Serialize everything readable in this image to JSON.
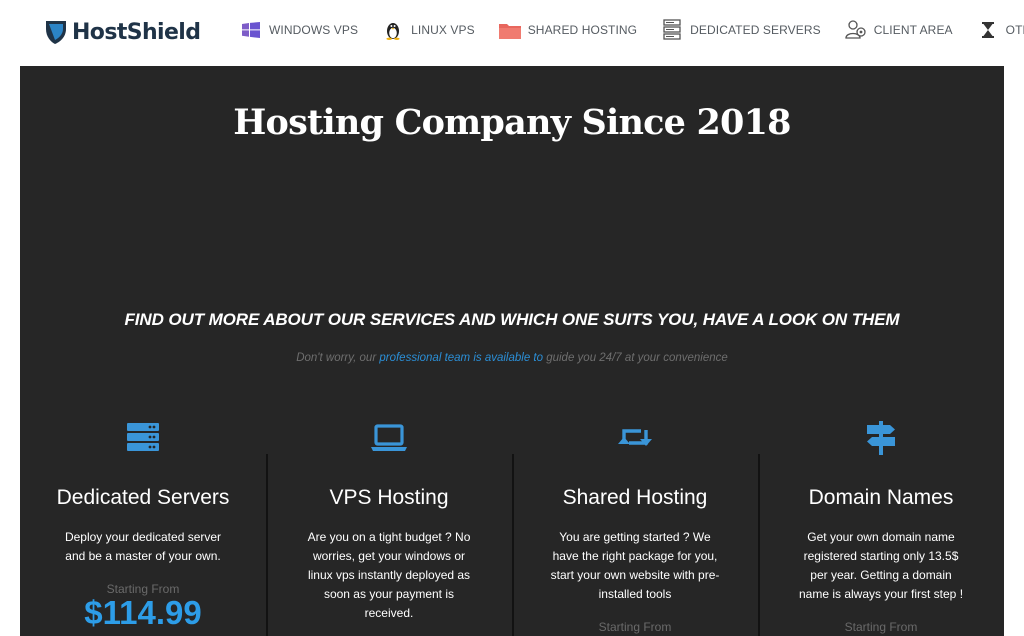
{
  "brand": {
    "name": "HostShield",
    "color": "#1f3347"
  },
  "nav": {
    "items": [
      {
        "label": "WINDOWS VPS",
        "icon": "windows-icon"
      },
      {
        "label": "LINUX VPS",
        "icon": "linux-penguin-icon"
      },
      {
        "label": "SHARED HOSTING",
        "icon": "folder-icon"
      },
      {
        "label": "DEDICATED SERVERS",
        "icon": "server-rack-icon"
      },
      {
        "label": "CLIENT AREA",
        "icon": "users-icon"
      },
      {
        "label": "OTHER",
        "icon": "hourglass-icon"
      }
    ]
  },
  "hero": {
    "title": "Hosting Company Since 2018",
    "subheading": "FIND OUT MORE ABOUT OUR SERVICES AND WHICH ONE SUITS YOU, HAVE A LOOK ON THEM",
    "tagline_pre": "Don't worry, our ",
    "tagline_link": "professional team is available to",
    "tagline_post": " guide you 24/7 at your convenience"
  },
  "services": [
    {
      "title": "Dedicated Servers",
      "icon": "server-icon",
      "description": "Deploy your dedicated server and be a master of your own.",
      "starting_from": "Starting From",
      "price": "$114.99"
    },
    {
      "title": "VPS Hosting",
      "icon": "laptop-icon",
      "description": "Are you on a tight budget ? No worries, get your windows or linux vps instantly deployed as soon as your payment is received."
    },
    {
      "title": "Shared Hosting",
      "icon": "retweet-icon",
      "description": "You are getting started ? We have the right package for you, start your own website with pre-installed tools",
      "starting_from": "Starting From"
    },
    {
      "title": "Domain Names",
      "icon": "signpost-icon",
      "description": "Get your own domain name registered starting only 13.5$ per year. Getting a domain name is always your first step !",
      "starting_from": "Starting From"
    }
  ],
  "colors": {
    "panel_bg": "#262626",
    "accent_blue": "#2d9de8",
    "link_blue": "#2b8fd7",
    "icon_blue": "#3a95d8"
  }
}
